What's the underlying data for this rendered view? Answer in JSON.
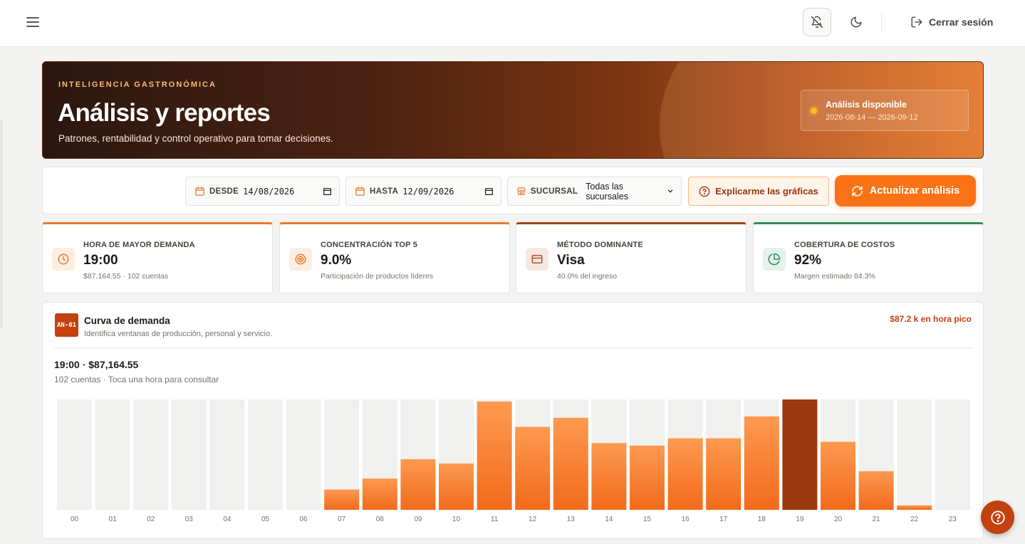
{
  "topbar": {
    "logout_label": "Cerrar sesión"
  },
  "hero": {
    "kicker": "INTELIGENCIA GASTRONÓMICA",
    "title": "Análisis y reportes",
    "subtitle": "Patrones, rentabilidad y control operativo para tomar decisiones.",
    "status_title": "Análisis disponible",
    "status_range": "2026-08-14 — 2026-09-12"
  },
  "filters": {
    "from_label": "DESDE",
    "from_value": "14/08/2026",
    "to_label": "HASTA",
    "to_value": "12/09/2026",
    "branch_label": "SUCURSAL",
    "branch_value": "Todas las sucursales",
    "explain_label": "Explicarme las gráficas",
    "refresh_label": "Actualizar análisis"
  },
  "kpis": [
    {
      "label": "HORA DE MAYOR DEMANDA",
      "value": "19:00",
      "foot": "$87,164.55 · 102 cuentas",
      "icon": "clock-icon",
      "accent": "#ea7a2c",
      "icon_bg": "#fdeee2",
      "icon_color": "#ea7a2c"
    },
    {
      "label": "CONCENTRACIÓN TOP 5",
      "value": "9.0%",
      "foot": "Participación de productos líderes",
      "icon": "target-icon",
      "accent": "#ea7a2c",
      "icon_bg": "#fdeee2",
      "icon_color": "#ea7a2c"
    },
    {
      "label": "MÉTODO DOMINANTE",
      "value": "Visa",
      "foot": "40.0% del ingreso",
      "icon": "credit-card-icon",
      "accent": "#a0441c",
      "icon_bg": "#f6e7e1",
      "icon_color": "#b4532a"
    },
    {
      "label": "COBERTURA DE COSTOS",
      "value": "92%",
      "foot": "Margen estimado 84.3%",
      "icon": "pie-chart-icon",
      "accent": "#2f8f5b",
      "icon_bg": "#e4f2ea",
      "icon_color": "#2f8f5b"
    }
  ],
  "chart_card": {
    "code": "AN-01",
    "title": "Curva de demanda",
    "subtitle": "Identifica ventanas de producción, personal y servicio.",
    "peak_note": "$87.2 k en hora pico",
    "selected": "19:00 · $87,164.55",
    "note": "102 cuentas · Toca una hora para consultar"
  },
  "chart_data": {
    "type": "bar",
    "categories": [
      "00",
      "01",
      "02",
      "03",
      "04",
      "05",
      "06",
      "07",
      "08",
      "09",
      "10",
      "11",
      "12",
      "13",
      "14",
      "15",
      "16",
      "17",
      "18",
      "19",
      "20",
      "21",
      "22",
      "23"
    ],
    "values": [
      0,
      0,
      0,
      0,
      0,
      0,
      0,
      16000,
      24700,
      40000,
      36600,
      85500,
      65500,
      72700,
      52700,
      50700,
      56500,
      56500,
      73800,
      87164.55,
      53700,
      30500,
      3500,
      0
    ],
    "ylim": [
      0,
      87164.55
    ],
    "highlight": "19",
    "colors": {
      "track": "#f0f0ef",
      "bar_top": "#fd9a50",
      "bar_bottom": "#f26a1b",
      "highlight": "#9a3a10"
    }
  }
}
